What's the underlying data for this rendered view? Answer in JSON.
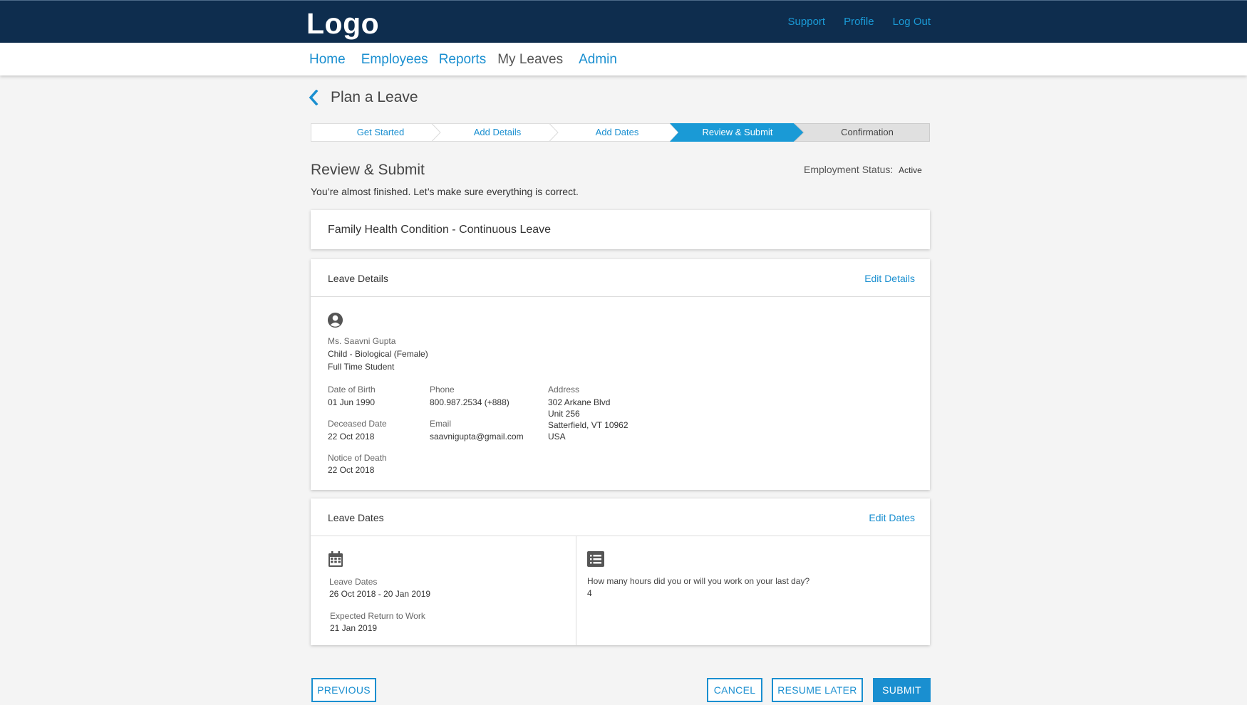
{
  "header": {
    "logo": "Logo",
    "links": {
      "support": "Support",
      "profile": "Profile",
      "logout": "Log Out"
    }
  },
  "nav": {
    "items": [
      "Home",
      "Employees",
      "Reports",
      "My Leaves",
      "Admin"
    ],
    "active": "My Leaves"
  },
  "page": {
    "title": "Plan a Leave"
  },
  "stepper": {
    "steps": [
      "Get Started",
      "Add Details",
      "Add Dates",
      "Review & Submit",
      "Confirmation"
    ],
    "current_index": 3
  },
  "review": {
    "heading": "Review & Submit",
    "employment_status_label": "Employment Status:",
    "employment_status_value": "Active",
    "subtext": "You’re almost finished. Let’s make sure everything is correct."
  },
  "leave_type": "Family Health Condition - Continuous Leave",
  "leave_details": {
    "title": "Leave Details",
    "edit_label": "Edit Details",
    "icon": "user-circle-icon",
    "person_name": "Ms. Saavni Gupta",
    "relationship": "Child - Biological (Female)",
    "status": "Full Time Student",
    "dob_label": "Date of Birth",
    "dob_value": "01 Jun 1990",
    "deceased_label": "Deceased Date",
    "deceased_value": "22 Oct 2018",
    "notice_label": "Notice of Death",
    "notice_value": "22 Oct 2018",
    "phone_label": "Phone",
    "phone_value": "800.987.2534 (+888)",
    "email_label": "Email",
    "email_value": "saavnigupta@gmail.com",
    "address_label": "Address",
    "address_lines": [
      "302 Arkane Blvd",
      "Unit 256",
      "Satterfield, VT 10962",
      "USA"
    ]
  },
  "leave_dates": {
    "title": "Leave Dates",
    "edit_label": "Edit Dates",
    "calendar_icon": "calendar-icon",
    "list_icon": "list-icon",
    "dates_label": "Leave Dates",
    "dates_value": "26 Oct 2018 - 20 Jan 2019",
    "return_label": "Expected Return to Work",
    "return_value": "21 Jan 2019",
    "question": "How many hours did you or will you work on your last day?",
    "answer": "4"
  },
  "buttons": {
    "previous": "PREVIOUS",
    "cancel": "CANCEL",
    "resume_later": "RESUME LATER",
    "submit": "SUBMIT"
  },
  "colors": {
    "topbar": "#0e2d4e",
    "accent": "#1a8fd0",
    "background": "#f4f4f4"
  }
}
